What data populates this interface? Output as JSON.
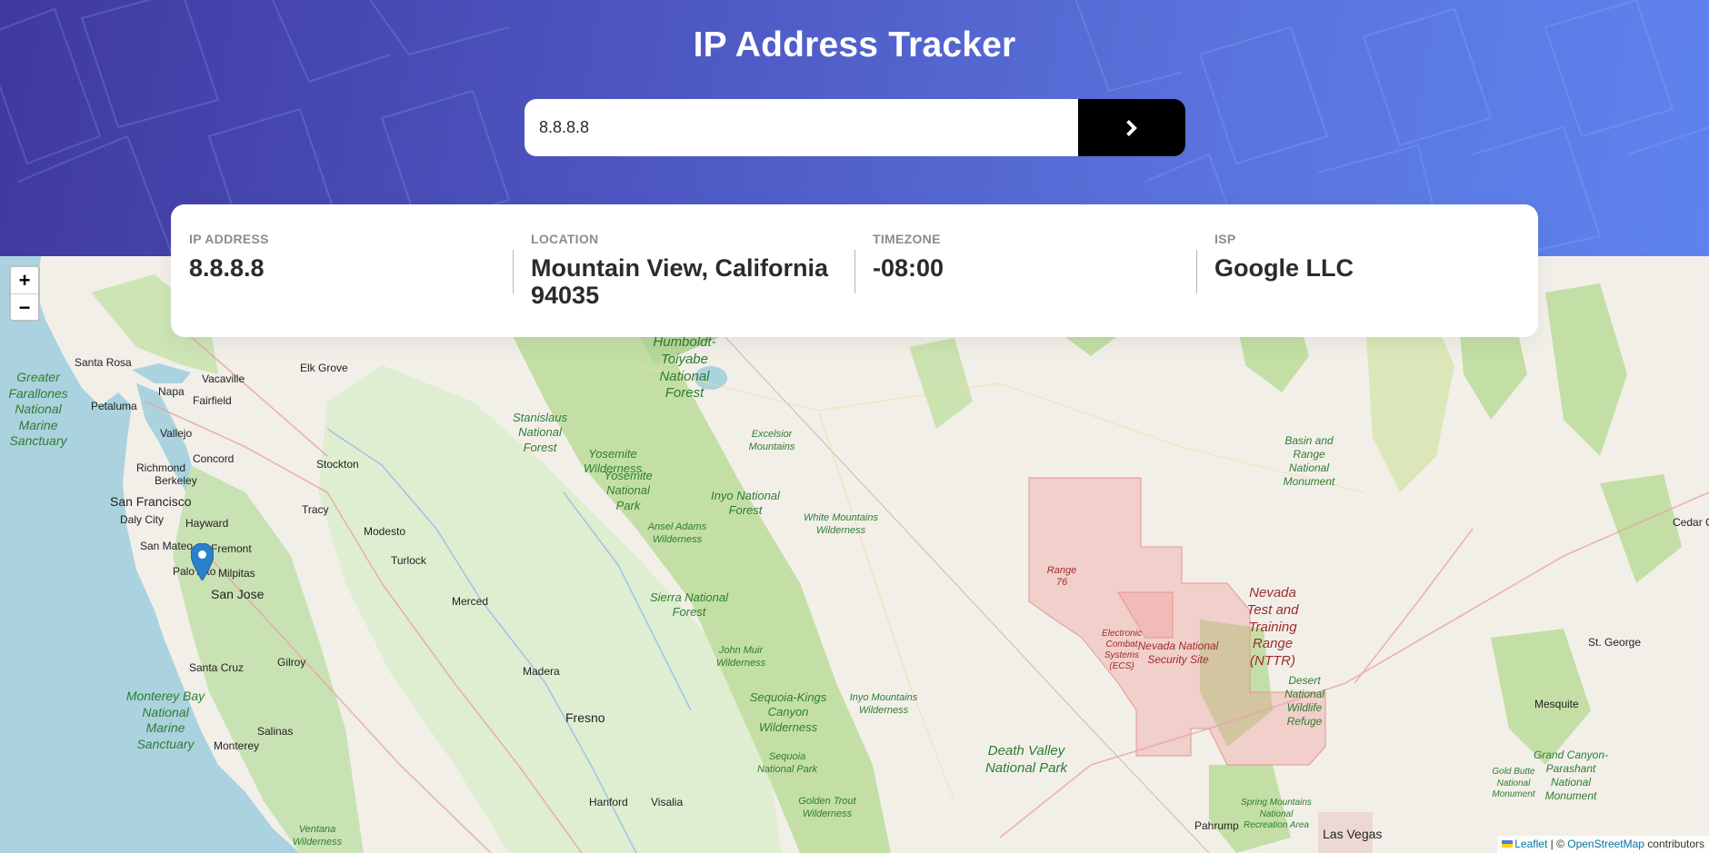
{
  "header": {
    "title": "IP Address Tracker",
    "search": {
      "value": "8.8.8.8",
      "placeholder": ""
    },
    "submit_icon": "chevron-right-icon"
  },
  "info": [
    {
      "label": "IP Address",
      "value": "8.8.8.8"
    },
    {
      "label": "Location",
      "value": "Mountain View, California 94035"
    },
    {
      "label": "Timezone",
      "value": "-08:00"
    },
    {
      "label": "ISP",
      "value": "Google LLC"
    }
  ],
  "map": {
    "zoom_in": "+",
    "zoom_out": "−",
    "marker_icon": "map-marker-icon",
    "attribution": {
      "leaflet": "Leaflet",
      "separator": " | © ",
      "osm": "OpenStreetMap",
      "suffix": " contributors"
    },
    "places": {
      "santa_rosa": "Santa Rosa",
      "napa": "Napa",
      "vacaville": "Vacaville",
      "elk_grove": "Elk Grove",
      "petaluma": "Petaluma",
      "fairfield": "Fairfield",
      "vallejo": "Vallejo",
      "concord": "Concord",
      "richmond": "Richmond",
      "berkeley": "Berkeley",
      "stockton": "Stockton",
      "san_francisco": "San Francisco",
      "tracy": "Tracy",
      "daly_city": "Daly City",
      "hayward": "Hayward",
      "modesto": "Modesto",
      "san_mateo": "San Mateo",
      "fremont": "Fremont",
      "palo_alto": "Palo Alto",
      "milpitas": "Milpitas",
      "san_jose": "San Jose",
      "turlock": "Turlock",
      "merced": "Merced",
      "santa_cruz": "Santa Cruz",
      "gilroy": "Gilroy",
      "madera": "Madera",
      "fresno": "Fresno",
      "salinas": "Salinas",
      "monterey": "Monterey",
      "hanford": "Hanford",
      "visalia": "Visalia",
      "pahrump": "Pahrump",
      "las_vegas": "Las Vegas",
      "st_george": "St. George",
      "mesquite": "Mesquite",
      "cedar_city": "Cedar Ci",
      "greater_farallones": "Greater Farallones National Marine Sanctuary",
      "monterey_bay": "Monterey Bay National Marine Sanctuary",
      "humboldt": "Humboldt-Toiyabe National Forest",
      "stanislaus": "Stanislaus National Forest",
      "yosemite_wild": "Yosemite Wilderness",
      "yosemite_park": "Yosemite National Park",
      "excelsior": "Excelsior Mountains",
      "inyo_forest": "Inyo National Forest",
      "ansel_adams": "Ansel Adams Wilderness",
      "white_mountains": "White Mountains Wilderness",
      "sierra_forest": "Sierra National Forest",
      "john_muir": "John Muir Wilderness",
      "sequoia_kings": "Sequoia-Kings Canyon Wilderness",
      "sequoia_park": "Sequoia National Park",
      "golden_trout": "Golden Trout Wilderness",
      "inyo_mountains": "Inyo Mountains Wilderness",
      "death_valley": "Death Valley National Park",
      "ventana": "Ventana Wilderness",
      "range76": "Range 76",
      "ecs": "Electronic Combat Systems (ECS)",
      "nnss": "Nevada National Security Site",
      "nttr": "Nevada Test and Training Range (NTTR)",
      "desert_refuge": "Desert National Wildlife Refuge",
      "basin_range": "Basin and Range National Monument",
      "spring_mountains": "Spring Mountains National Recreation Area",
      "gold_butte": "Gold Butte National Monument",
      "grand_canyon": "Grand Canyon-Parashant National Monument"
    }
  }
}
